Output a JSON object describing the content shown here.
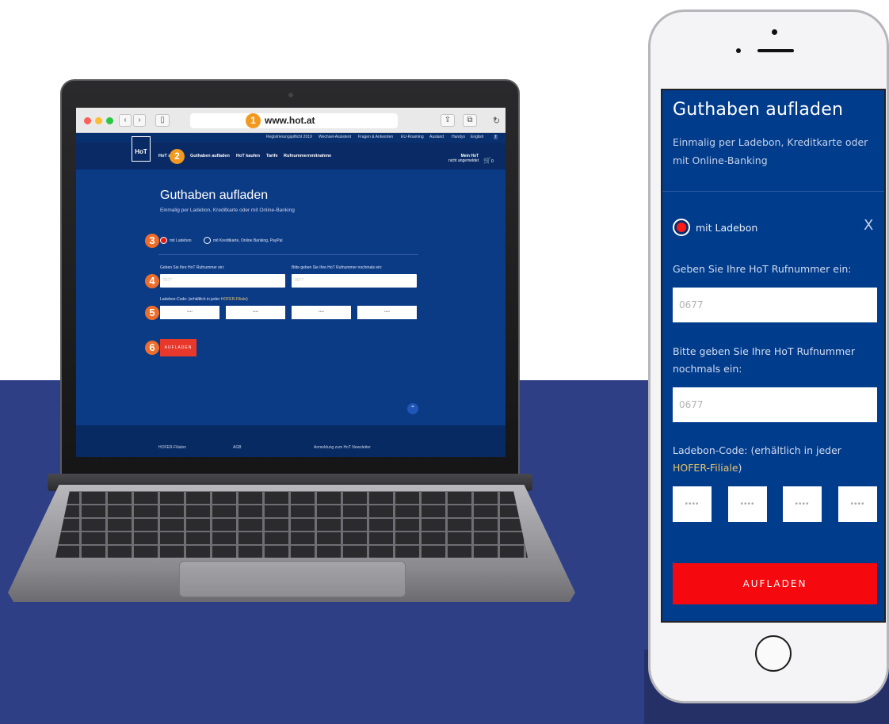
{
  "colors": {
    "backdrop": "#2e3f86",
    "site_blue": "#003c8c",
    "cta_red": "#f5090e",
    "step_orange": "#f29a1f",
    "link_yellow": "#e7c46a"
  },
  "laptop": {
    "browser": {
      "url": "www.hot.at",
      "nav_back": "‹",
      "nav_forward": "›",
      "reload_icon": "↻",
      "share_icon": "⇪",
      "tabs_icon": "⧉",
      "new_tab_icon": "+"
    },
    "steps": [
      "1",
      "2",
      "3",
      "4",
      "5",
      "6"
    ],
    "top_links": [
      "Registrierungspflicht 2019",
      "Wechsel-Assistent",
      "Fragen & Antworten",
      "EU-Roaming",
      "Ausland",
      "Handys",
      "English"
    ],
    "logo": "HoT",
    "nav": {
      "home": "HoT st",
      "items": [
        "Guthaben aufladen",
        "HoT kaufen",
        "Tarife",
        "Rufnummernmitnahme"
      ],
      "account_title": "Mein HoT",
      "account_status": "nicht angemeldet",
      "cart_icon": "🛒",
      "cart_count": "0"
    },
    "page": {
      "title": "Guthaben aufladen",
      "subtitle": "Einmalig per Ladebon, Kreditkarte oder mit Online-Banking",
      "option_ladebon": "mit Ladebon",
      "option_card": "mit Kreditkarte, Online Banking, PayPal",
      "label_number": "Geben Sie Ihre HoT Rufnummer ein:",
      "label_number_repeat": "Bitte geben Sie Ihre HoT Rufnummer nochmals ein:",
      "number_placeholder": "0677",
      "label_code": "Ladebon-Code: (erhältlich in jeder",
      "label_code_link": "HOFER-Filiale",
      "label_code_end": ")",
      "code_placeholder": "••••",
      "button": "AUFLADEN",
      "scroll_up_icon": "⌃"
    },
    "footer": [
      "HOFER-Filialen",
      "AGB",
      "Anmeldung zum HoT Newsletter"
    ]
  },
  "phone": {
    "title": "Guthaben aufladen",
    "subtitle": "Einmalig per Ladebon, Kreditkarte oder mit Online-Banking",
    "option_ladebon": "mit Ladebon",
    "close_icon": "X",
    "label_number": "Geben Sie Ihre HoT Rufnummer ein:",
    "number_placeholder": "0677",
    "label_number_repeat": "Bitte geben Sie Ihre HoT Rufnummer nochmals ein:",
    "number_repeat_placeholder": "0677",
    "label_code": "Ladebon-Code: (erhältlich in jeder ",
    "label_code_link": "HOFER-Filiale",
    "label_code_end": ")",
    "code_placeholder": "••••",
    "button": "AUFLADEN"
  }
}
